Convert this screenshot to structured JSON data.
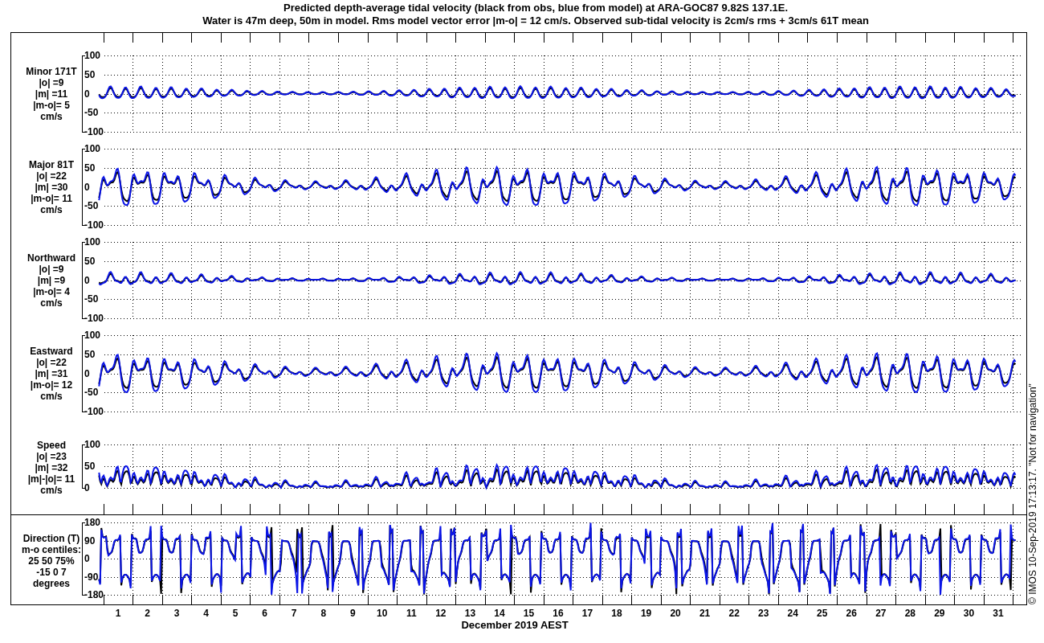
{
  "title_lines": [
    "Predicted depth-average tidal velocity (black from obs, blue from model) at ARA-GOC87 9.82S 137.1E.",
    "Water is 47m deep, 50m in model. Rms model vector error |m-o| = 12 cm/s. Observed sub-tidal velocity is 2cm/s rms + 3cm/s 61T mean"
  ],
  "panels": [
    {
      "kind": "minor",
      "label_lines": [
        "Minor 171T",
        "|o| =9",
        "|m| =11",
        "|m-o|= 5",
        "cm/s"
      ],
      "yticks": [
        "100",
        "50",
        "0",
        "-50",
        "-100"
      ]
    },
    {
      "kind": "major",
      "label_lines": [
        "Major 81T",
        "|o| =22",
        "|m| =30",
        "|m-o|= 11",
        "cm/s"
      ],
      "yticks": [
        "100",
        "50",
        "0",
        "-50",
        "-100"
      ]
    },
    {
      "kind": "north",
      "label_lines": [
        "Northward",
        "|o| =9",
        "|m| =9",
        "|m-o|= 4",
        "cm/s"
      ],
      "yticks": [
        "100",
        "50",
        "0",
        "-50",
        "-100"
      ]
    },
    {
      "kind": "east",
      "label_lines": [
        "Eastward",
        "|o| =22",
        "|m| =31",
        "|m-o|= 12",
        "cm/s"
      ],
      "yticks": [
        "100",
        "50",
        "0",
        "-50",
        "-100"
      ]
    },
    {
      "kind": "speed",
      "label_lines": [
        "Speed",
        "|o| =23",
        "|m| =32",
        "|m|-|o|= 11",
        "cm/s"
      ],
      "yticks": [
        "100",
        "50",
        "0"
      ]
    },
    {
      "kind": "direction",
      "label_lines": [
        "Direction (T)",
        "m-o centiles:",
        "25  50  75%",
        "-15   0   7",
        "degrees"
      ],
      "yticks": [
        "180",
        "90",
        "0",
        "-90",
        "-180"
      ]
    }
  ],
  "x_axis": {
    "ticks": [
      "1",
      "2",
      "3",
      "4",
      "5",
      "6",
      "7",
      "8",
      "9",
      "10",
      "11",
      "12",
      "13",
      "14",
      "15",
      "16",
      "17",
      "18",
      "19",
      "20",
      "21",
      "22",
      "23",
      "24",
      "25",
      "26",
      "27",
      "28",
      "29",
      "30",
      "31"
    ],
    "label": "December 2019 AEST"
  },
  "credit": "© IMOS 10-Sep-2019 17:13:17. \"Not for navigation\""
}
